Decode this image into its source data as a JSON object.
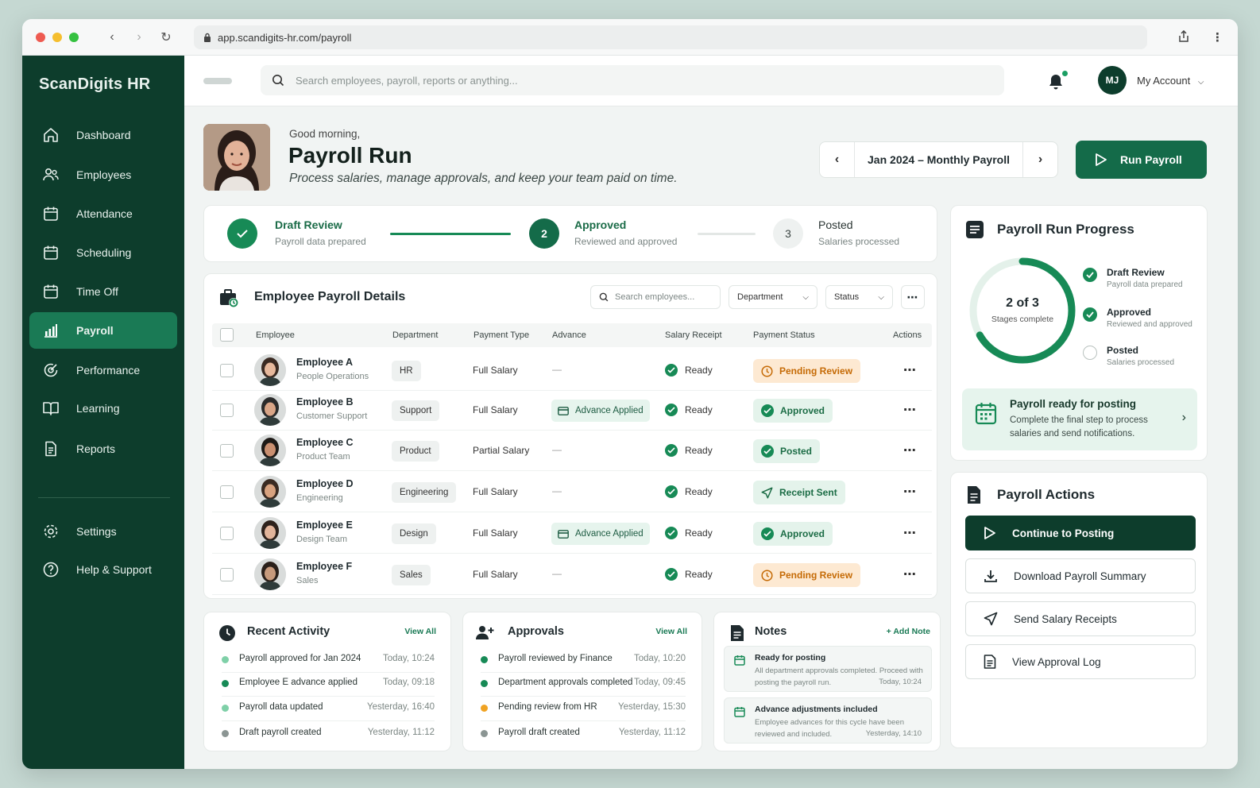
{
  "browser": {
    "url": "app.scandigits-hr.com/payroll"
  },
  "brand": "ScanDigits HR",
  "sidebar": {
    "items": [
      {
        "label": "Dashboard",
        "icon": "home-icon"
      },
      {
        "label": "Employees",
        "icon": "users-icon"
      },
      {
        "label": "Attendance",
        "icon": "calendar-icon"
      },
      {
        "label": "Scheduling",
        "icon": "calendar-icon"
      },
      {
        "label": "Time Off",
        "icon": "calendar-icon"
      },
      {
        "label": "Payroll",
        "icon": "bar-chart-icon"
      },
      {
        "label": "Performance",
        "icon": "target-icon"
      },
      {
        "label": "Learning",
        "icon": "book-icon"
      },
      {
        "label": "Reports",
        "icon": "document-icon"
      }
    ],
    "bottom": [
      {
        "label": "Settings",
        "icon": "gear-icon"
      },
      {
        "label": "Help & Support",
        "icon": "help-icon"
      }
    ]
  },
  "topbar": {
    "search_placeholder": "Search employees, payroll, reports or anything...",
    "user_initials": "MJ",
    "account_label": "My Account"
  },
  "header": {
    "greeting": "Good morning,",
    "title": "Payroll Run",
    "subtitle": "Process salaries, manage approvals, and keep your team paid on time.",
    "period": "Jan 2024 – Monthly Payroll",
    "run_button": "Run Payroll"
  },
  "stepper": [
    {
      "number": "",
      "title": "Draft Review",
      "sub": "Payroll data prepared",
      "state": "done"
    },
    {
      "number": "2",
      "title": "Approved",
      "sub": "Reviewed and approved",
      "state": "current"
    },
    {
      "number": "3",
      "title": "Posted",
      "sub": "Salaries processed",
      "state": "pending"
    }
  ],
  "table": {
    "title": "Employee Payroll Details",
    "search_placeholder": "Search employees...",
    "filters": [
      "Department",
      "Status"
    ],
    "columns": [
      "Employee",
      "Department",
      "Payment Type",
      "Advance",
      "Salary Receipt",
      "Payment Status",
      "Actions"
    ],
    "rows": [
      {
        "name": "Employee A",
        "team": "People Operations",
        "dept": "HR",
        "ptype": "Full Salary",
        "advance": "—",
        "receipt": "Ready",
        "status": "Pending Review",
        "kind": "pending"
      },
      {
        "name": "Employee B",
        "team": "Customer Support",
        "dept": "Support",
        "ptype": "Full Salary",
        "advance": "Advance Applied",
        "receipt": "Ready",
        "status": "Approved",
        "kind": "approved"
      },
      {
        "name": "Employee C",
        "team": "Product Team",
        "dept": "Product",
        "ptype": "Partial Salary",
        "advance": "—",
        "receipt": "Ready",
        "status": "Posted",
        "kind": "posted"
      },
      {
        "name": "Employee D",
        "team": "Engineering",
        "dept": "Engineering",
        "ptype": "Full Salary",
        "advance": "—",
        "receipt": "Ready",
        "status": "Receipt Sent",
        "kind": "receipt"
      },
      {
        "name": "Employee E",
        "team": "Design Team",
        "dept": "Design",
        "ptype": "Full Salary",
        "advance": "Advance Applied",
        "receipt": "Ready",
        "status": "Approved",
        "kind": "approved"
      },
      {
        "name": "Employee F",
        "team": "Sales",
        "dept": "Sales",
        "ptype": "Full Salary",
        "advance": "—",
        "receipt": "Ready",
        "status": "Pending Review",
        "kind": "pending"
      }
    ]
  },
  "recent_activity": {
    "title": "Recent Activity",
    "view_all": "View All",
    "items": [
      {
        "text": "Payroll approved for Jan 2024",
        "time": "Today, 10:24",
        "color": "#7fd0a8"
      },
      {
        "text": "Employee E advance applied",
        "time": "Today, 09:18",
        "color": "#178a56"
      },
      {
        "text": "Payroll data updated",
        "time": "Yesterday, 16:40",
        "color": "#7fd0a8"
      },
      {
        "text": "Draft payroll created",
        "time": "Yesterday, 11:12",
        "color": "#8b9593"
      }
    ]
  },
  "approvals": {
    "title": "Approvals",
    "view_all": "View All",
    "items": [
      {
        "text": "Payroll reviewed by Finance",
        "time": "Today, 10:20",
        "color": "#178a56"
      },
      {
        "text": "Department approvals completed",
        "time": "Today, 09:45",
        "color": "#178a56"
      },
      {
        "text": "Pending review from HR",
        "time": "Yesterday, 15:30",
        "color": "#f0a323"
      },
      {
        "text": "Payroll draft created",
        "time": "Yesterday, 11:12",
        "color": "#8b9593"
      }
    ]
  },
  "notes": {
    "title": "Notes",
    "add": "+ Add Note",
    "items": [
      {
        "title": "Ready for posting",
        "body": "All department approvals completed. Proceed with posting the payroll run.",
        "time": "Today, 10:24"
      },
      {
        "title": "Advance adjustments included",
        "body": "Employee advances for this cycle have been reviewed and included.",
        "time": "Yesterday, 14:10"
      }
    ]
  },
  "progress": {
    "title": "Payroll Run Progress",
    "center": "2 of 3",
    "center_sub": "Stages complete",
    "completed_fraction": 0.6667,
    "steps": [
      {
        "title": "Draft Review",
        "sub": "Payroll data prepared",
        "done": true
      },
      {
        "title": "Approved",
        "sub": "Reviewed and approved",
        "done": true
      },
      {
        "title": "Posted",
        "sub": "Salaries processed",
        "done": false
      }
    ],
    "ready_title": "Payroll ready for posting",
    "ready_sub": "Complete the final step to process salaries and send notifications."
  },
  "actions": {
    "title": "Payroll Actions",
    "buttons": [
      {
        "label": "Continue to Posting",
        "icon": "play-icon",
        "primary": true
      },
      {
        "label": "Download Payroll Summary",
        "icon": "download-icon",
        "primary": false
      },
      {
        "label": "Send Salary Receipts",
        "icon": "send-icon",
        "primary": false
      },
      {
        "label": "View Approval Log",
        "icon": "document-icon",
        "primary": false
      }
    ]
  },
  "colors": {
    "brand_dark": "#0d3d2c",
    "brand_green": "#146b49",
    "accent": "#178a56",
    "pending": "#c56a05"
  }
}
